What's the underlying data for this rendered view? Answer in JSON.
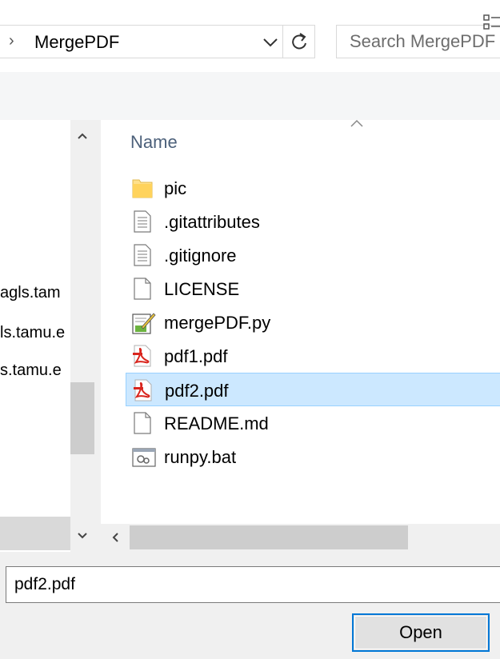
{
  "address_bar": {
    "separator": "›",
    "current_folder": "MergePDF",
    "search_placeholder": "Search MergePDF"
  },
  "nav_pane": {
    "items": [
      {
        "label": "agls.tam"
      },
      {
        "label": "ls.tamu.e"
      },
      {
        "label": "s.tamu.e"
      }
    ]
  },
  "file_list": {
    "column_name": "Name",
    "rows": [
      {
        "name": "pic",
        "icon": "folder-icon"
      },
      {
        "name": ".gitattributes",
        "icon": "text-file-icon"
      },
      {
        "name": ".gitignore",
        "icon": "text-file-icon"
      },
      {
        "name": "LICENSE",
        "icon": "blank-file-icon"
      },
      {
        "name": "mergePDF.py",
        "icon": "python-file-icon"
      },
      {
        "name": "pdf1.pdf",
        "icon": "pdf-file-icon"
      },
      {
        "name": "pdf2.pdf",
        "icon": "pdf-file-icon",
        "selected": true
      },
      {
        "name": "README.md",
        "icon": "blank-file-icon"
      },
      {
        "name": "runpy.bat",
        "icon": "batch-file-icon"
      }
    ]
  },
  "bottom": {
    "filename_value": "pdf2.pdf",
    "open_label": "Open"
  },
  "colors": {
    "selection_bg": "#cce8ff",
    "selection_border": "#99d1ff",
    "accent": "#0078d7",
    "column_header": "#4c607a"
  }
}
